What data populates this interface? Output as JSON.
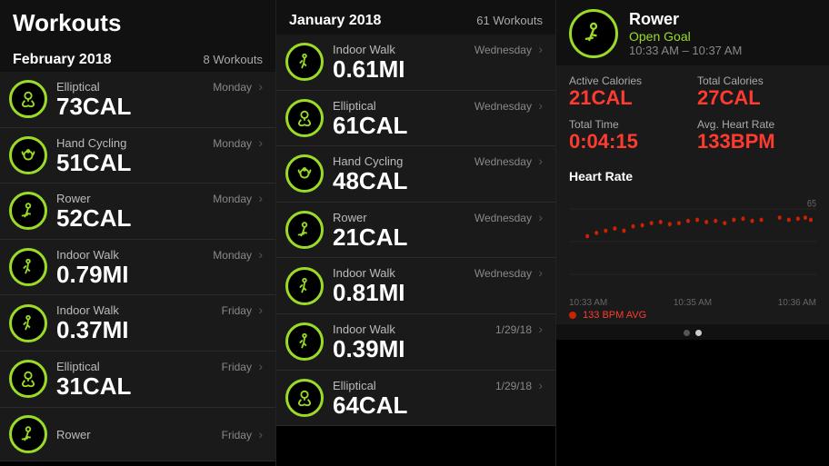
{
  "left_panel": {
    "title": "Workouts",
    "section_title": "February 2018",
    "section_count": "8 Workouts",
    "workouts": [
      {
        "name": "Elliptical",
        "day": "Monday",
        "value": "73CAL",
        "icon": "elliptical"
      },
      {
        "name": "Hand Cycling",
        "day": "Monday",
        "value": "51CAL",
        "icon": "hand-cycling"
      },
      {
        "name": "Rower",
        "day": "Monday",
        "value": "52CAL",
        "icon": "rower"
      },
      {
        "name": "Indoor Walk",
        "day": "Monday",
        "value": "0.79MI",
        "icon": "walk"
      },
      {
        "name": "Indoor Walk",
        "day": "Friday",
        "value": "0.37MI",
        "icon": "walk"
      },
      {
        "name": "Elliptical",
        "day": "Friday",
        "value": "31CAL",
        "icon": "elliptical"
      },
      {
        "name": "Rower",
        "day": "Friday",
        "value": "",
        "icon": "rower"
      }
    ]
  },
  "mid_panel": {
    "section_title": "January 2018",
    "section_count": "61 Workouts",
    "workouts": [
      {
        "name": "Indoor Walk",
        "day": "Wednesday",
        "value": "0.61MI",
        "icon": "walk"
      },
      {
        "name": "Elliptical",
        "day": "Wednesday",
        "value": "61CAL",
        "icon": "elliptical"
      },
      {
        "name": "Hand Cycling",
        "day": "Wednesday",
        "value": "48CAL",
        "icon": "hand-cycling"
      },
      {
        "name": "Rower",
        "day": "Wednesday",
        "value": "21CAL",
        "icon": "rower"
      },
      {
        "name": "Indoor Walk",
        "day": "Wednesday",
        "value": "0.81MI",
        "icon": "walk"
      },
      {
        "name": "Indoor Walk",
        "day": "1/29/18",
        "value": "0.39MI",
        "icon": "walk"
      },
      {
        "name": "Elliptical",
        "day": "1/29/18",
        "value": "64CAL",
        "icon": "elliptical"
      }
    ]
  },
  "right_panel": {
    "workout_name": "Rower",
    "goal": "Open Goal",
    "time_range": "10:33 AM – 10:37 AM",
    "active_calories_label": "Active Calories",
    "active_calories_value": "21CAL",
    "total_calories_label": "Total Calories",
    "total_calories_value": "27CAL",
    "total_time_label": "Total Time",
    "total_time_value": "0:04:15",
    "avg_hr_label": "Avg. Heart Rate",
    "avg_hr_value": "133BPM",
    "heart_rate_title": "Heart Rate",
    "hr_time_labels": [
      "10:33 AM",
      "10:35 AM",
      "10:36 AM"
    ],
    "hr_right_label": "65",
    "hr_avg_text": "133 BPM AVG",
    "page_dots": [
      "inactive",
      "active"
    ]
  }
}
